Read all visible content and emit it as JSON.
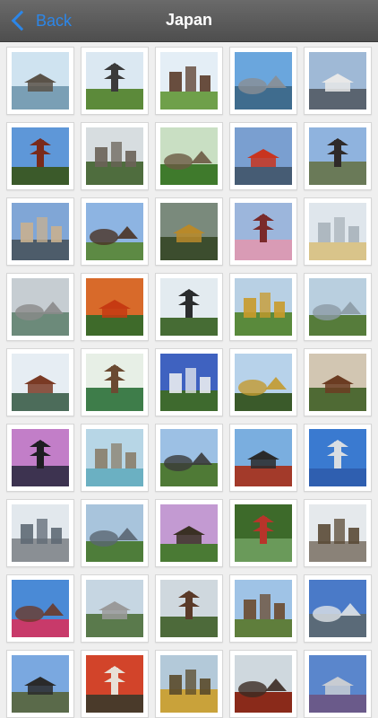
{
  "nav": {
    "back_label": "Back",
    "title": "Japan"
  },
  "gallery": {
    "photos": [
      {
        "icon": "coast-rock-photo",
        "sky": "#cfe3f0",
        "ground": "#7a9fb5",
        "accent": "#5a5248"
      },
      {
        "icon": "villa-garden-photo",
        "sky": "#dbe8f2",
        "ground": "#5c8a3a",
        "accent": "#3b3a3a"
      },
      {
        "icon": "temple-lawn-photo",
        "sky": "#e4eef6",
        "ground": "#6fa04a",
        "accent": "#5a3b2a"
      },
      {
        "icon": "city-river-photo",
        "sky": "#6aa6dd",
        "ground": "#3f6c8e",
        "accent": "#8a8f95"
      },
      {
        "icon": "train-city-photo",
        "sky": "#9fb9d6",
        "ground": "#5a6470",
        "accent": "#e8e8e8"
      },
      {
        "icon": "pagoda-photo",
        "sky": "#5e97d8",
        "ground": "#3b5a2a",
        "accent": "#7a2a1a"
      },
      {
        "icon": "shrine-mountain-photo",
        "sky": "#d7dde0",
        "ground": "#4f6d3e",
        "accent": "#6a6258"
      },
      {
        "icon": "garden-house-photo",
        "sky": "#c9dfc3",
        "ground": "#3f7a2c",
        "accent": "#6b5a44"
      },
      {
        "icon": "torii-gate-photo",
        "sky": "#7a9fd0",
        "ground": "#465c74",
        "accent": "#c8341f"
      },
      {
        "icon": "castle-blossom-photo",
        "sky": "#8fb3de",
        "ground": "#6a7a58",
        "accent": "#2f2a28"
      },
      {
        "icon": "canal-city-photo",
        "sky": "#80a6d6",
        "ground": "#4d5c6a",
        "accent": "#c8b090"
      },
      {
        "icon": "pavilion-bridge-photo",
        "sky": "#8db4e2",
        "ground": "#5d8a44",
        "accent": "#4a3224"
      },
      {
        "icon": "reflection-temple-photo",
        "sky": "#7a8a7c",
        "ground": "#3c4d2e",
        "accent": "#b8892a"
      },
      {
        "icon": "fuji-pagoda-photo",
        "sky": "#9cb6dc",
        "ground": "#d99bb5",
        "accent": "#7a2a2a"
      },
      {
        "icon": "modern-building-photo",
        "sky": "#dfe6ec",
        "ground": "#d9c48a",
        "accent": "#a9b3bb"
      },
      {
        "icon": "harbor-view-photo",
        "sky": "#c6cdd2",
        "ground": "#6c8a7a",
        "accent": "#8a8a8a"
      },
      {
        "icon": "autumn-maple-photo",
        "sky": "#d86a2a",
        "ground": "#3e6a2a",
        "accent": "#c63a12"
      },
      {
        "icon": "pagoda-garden-photo",
        "sky": "#e3ebf0",
        "ground": "#466c34",
        "accent": "#2b2d2e"
      },
      {
        "icon": "golden-pavilion-photo",
        "sky": "#b8d0e4",
        "ground": "#5a8a3c",
        "accent": "#c99a2a"
      },
      {
        "icon": "moss-garden-photo",
        "sky": "#b9cfdf",
        "ground": "#567c3b",
        "accent": "#8c9aa5"
      },
      {
        "icon": "phoenix-hall-photo",
        "sky": "#e6edf3",
        "ground": "#4c6c5a",
        "accent": "#7a3a24"
      },
      {
        "icon": "pond-temple-photo",
        "sky": "#e7efe6",
        "ground": "#3e7d4a",
        "accent": "#6b4a32"
      },
      {
        "icon": "white-castle-photo",
        "sky": "#3f62c0",
        "ground": "#3e6a2e",
        "accent": "#e9ecef"
      },
      {
        "icon": "pine-gold-temple-photo",
        "sky": "#b7d2ea",
        "ground": "#3a5a2a",
        "accent": "#c39a2f"
      },
      {
        "icon": "wooden-stage-photo",
        "sky": "#d2c6b2",
        "ground": "#4f6a34",
        "accent": "#6b3c22"
      },
      {
        "icon": "night-castle-photo",
        "sky": "#c27ec8",
        "ground": "#3d3350",
        "accent": "#1e1e22"
      },
      {
        "icon": "hot-spring-photo",
        "sky": "#b7d6e6",
        "ground": "#6bb0c2",
        "accent": "#8a7e6a"
      },
      {
        "icon": "castle-hill-photo",
        "sky": "#9cc0e4",
        "ground": "#4f7a36",
        "accent": "#3a3a3a"
      },
      {
        "icon": "castle-bridge-photo",
        "sky": "#7aaedf",
        "ground": "#a33a2a",
        "accent": "#2a2a2a"
      },
      {
        "icon": "spiral-tower-photo",
        "sky": "#3a7ad0",
        "ground": "#2f5fb0",
        "accent": "#d8dde2"
      },
      {
        "icon": "skyline-photo",
        "sky": "#e2e8ed",
        "ground": "#8a8f94",
        "accent": "#5f6a74"
      },
      {
        "icon": "palace-park-photo",
        "sky": "#a8c4dc",
        "ground": "#4e7d3a",
        "accent": "#5a6672"
      },
      {
        "icon": "mountain-teahouse-photo",
        "sky": "#c39ad2",
        "ground": "#4a7a34",
        "accent": "#3a3024"
      },
      {
        "icon": "red-bridge-photo",
        "sky": "#3d6a2a",
        "ground": "#6a9a5a",
        "accent": "#b8342a"
      },
      {
        "icon": "station-street-photo",
        "sky": "#e5e9ec",
        "ground": "#8a8278",
        "accent": "#5a4a36"
      },
      {
        "icon": "pagoda-flowers-photo",
        "sky": "#4a8ad6",
        "ground": "#c83a6a",
        "accent": "#6a3a2a"
      },
      {
        "icon": "stone-bridge-photo",
        "sky": "#c6d6e2",
        "ground": "#5a7a4c",
        "accent": "#9a9a9a"
      },
      {
        "icon": "mountain-temple-photo",
        "sky": "#cfd8de",
        "ground": "#4d6a3a",
        "accent": "#5a3a28"
      },
      {
        "icon": "thatched-house-photo",
        "sky": "#9fc3e6",
        "ground": "#5f7e3c",
        "accent": "#6a4a2e"
      },
      {
        "icon": "twin-towers-photo",
        "sky": "#4a7ac8",
        "ground": "#5a6a78",
        "accent": "#dfe3e7"
      },
      {
        "icon": "castle-tower-photo",
        "sky": "#7aa8e0",
        "ground": "#5a6a4a",
        "accent": "#2a2a2a"
      },
      {
        "icon": "maple-roof-photo",
        "sky": "#d2442a",
        "ground": "#4a3a2a",
        "accent": "#e8e0d6"
      },
      {
        "icon": "gold-roof-photo",
        "sky": "#b3c9d9",
        "ground": "#c9a23a",
        "accent": "#5a4a2a"
      },
      {
        "icon": "red-shrine-photo",
        "sky": "#cfd8de",
        "ground": "#8a2a1a",
        "accent": "#3a2a22"
      },
      {
        "icon": "blue-tower-photo",
        "sky": "#5a86cc",
        "ground": "#6a5a8a",
        "accent": "#c8ccd2"
      }
    ]
  }
}
